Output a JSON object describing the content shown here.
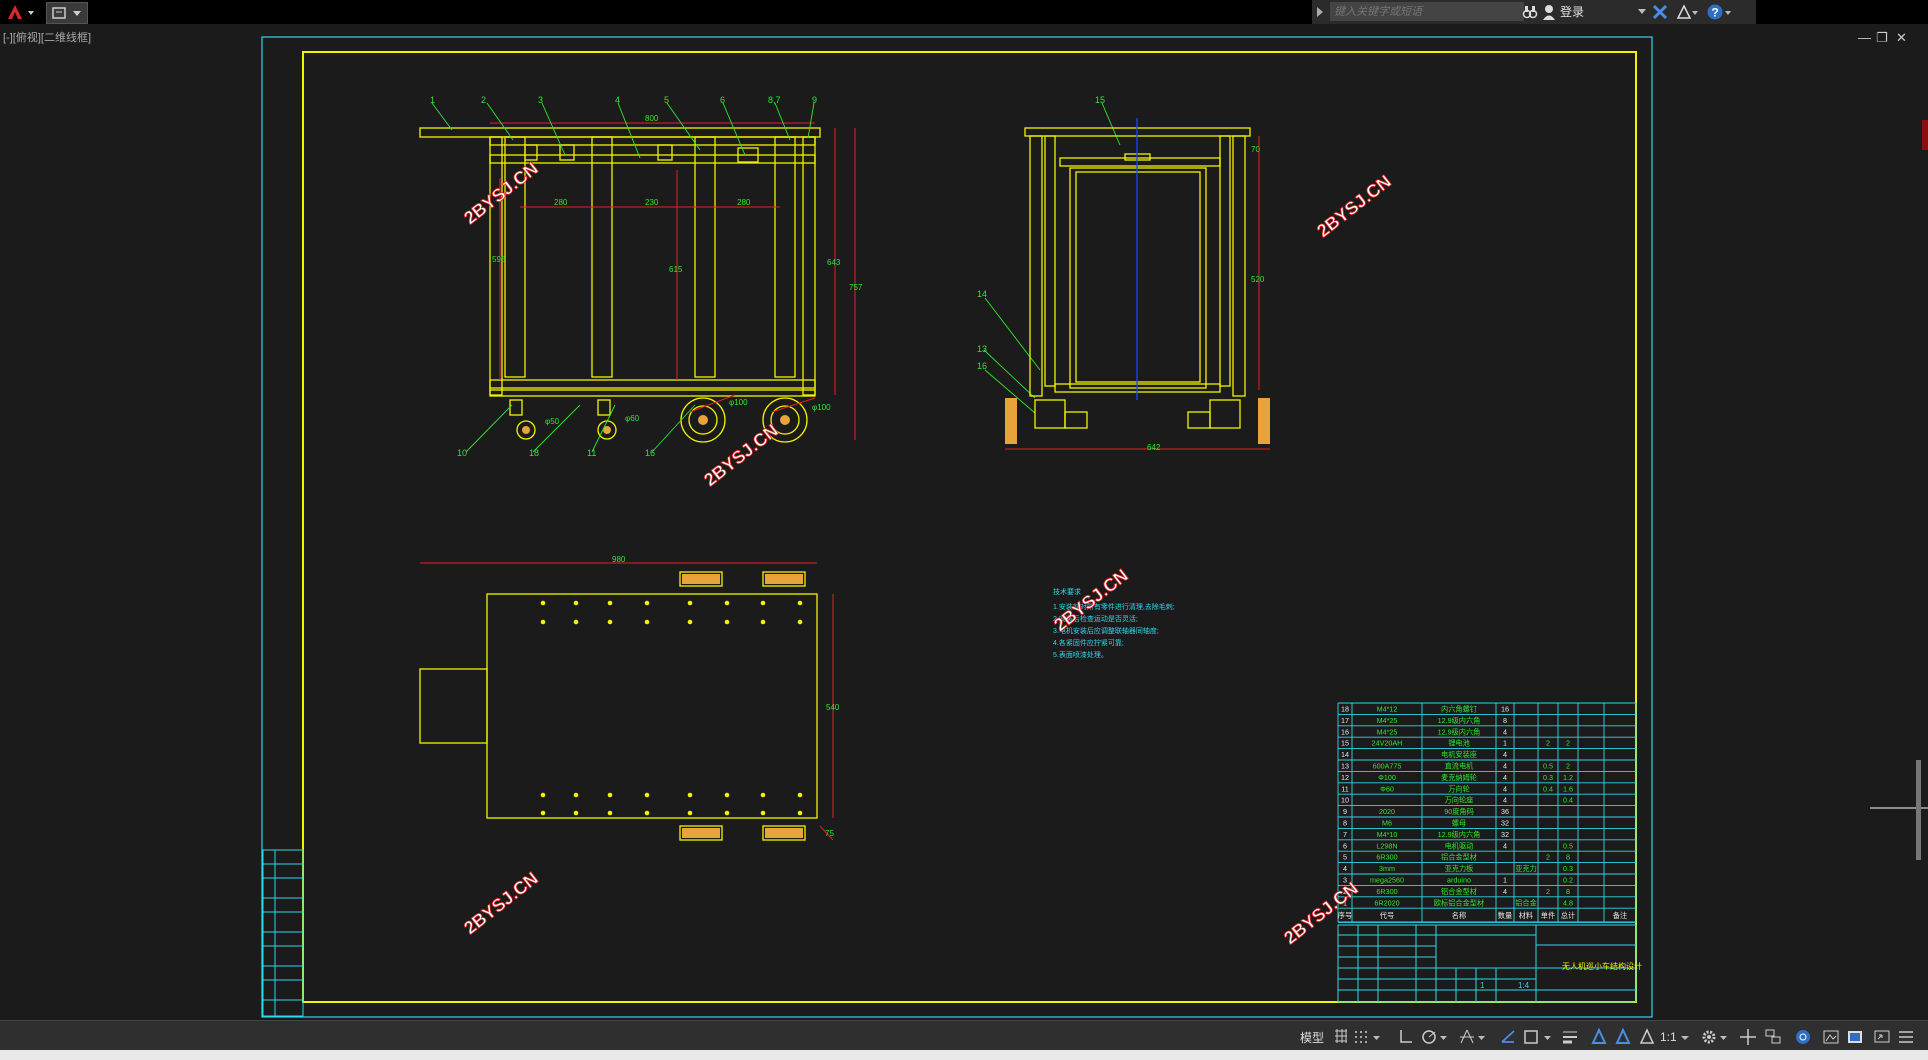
{
  "topbar": {
    "app_icon": "autocad-a-icon",
    "search_placeholder": "键入关键字或短语",
    "login_label": "登录"
  },
  "viewport": {
    "label": "[-][俯视][二维线框]"
  },
  "drawing": {
    "watermark": "2BYSJ.CN",
    "balloons": [
      "1",
      "2",
      "3",
      "4",
      "5",
      "6",
      "8,7",
      "9",
      "10",
      "18",
      "11",
      "16",
      "15",
      "14",
      "13",
      "16"
    ],
    "dims_front": {
      "top": "800",
      "d1": "280",
      "d2": "230",
      "d3": "280",
      "h1": "595",
      "h2": "615",
      "h3": "643",
      "h4": "757",
      "w1": "φ50",
      "w2": "φ60",
      "w3": "φ100",
      "w4": "φ100"
    },
    "dims_side": {
      "h1": "70",
      "h2": "520",
      "bottom": "642"
    },
    "dims_top": {
      "width": "980",
      "height": "540",
      "small": "75"
    },
    "notes_title": "技术要求",
    "notes": [
      "1.安装前对所有零件进行清理,去除毛刺;",
      "2.安装后检查运动是否灵活;",
      "3.电机安装后应调整联轴器同轴度;",
      "4.各紧固件应拧紧可靠;",
      "5.表面喷漆处理。"
    ],
    "bom": [
      {
        "no": "18",
        "code": "M4*12",
        "name": "内六角螺钉",
        "qty": "16",
        "mat": "",
        "w1": "",
        "w2": ""
      },
      {
        "no": "17",
        "code": "M4*25",
        "name": "12.9级内六角",
        "qty": "8",
        "mat": "",
        "w1": "",
        "w2": ""
      },
      {
        "no": "16",
        "code": "M4*25",
        "name": "12.9级内六角",
        "qty": "4",
        "mat": "",
        "w1": "",
        "w2": ""
      },
      {
        "no": "15",
        "code": "24V20AH",
        "name": "锂电池",
        "qty": "1",
        "mat": "",
        "w1": "2",
        "w2": "2"
      },
      {
        "no": "14",
        "code": "",
        "name": "电机安装座",
        "qty": "4",
        "mat": "",
        "w1": "",
        "w2": ""
      },
      {
        "no": "13",
        "code": "600A775",
        "name": "直流电机",
        "qty": "4",
        "mat": "",
        "w1": "0.5",
        "w2": "2"
      },
      {
        "no": "12",
        "code": "Φ100",
        "name": "麦克纳姆轮",
        "qty": "4",
        "mat": "",
        "w1": "0.3",
        "w2": "1.2"
      },
      {
        "no": "11",
        "code": "Φ60",
        "name": "万向轮",
        "qty": "4",
        "mat": "",
        "w1": "0.4",
        "w2": "1.6"
      },
      {
        "no": "10",
        "code": "",
        "name": "万向轮座",
        "qty": "4",
        "mat": "",
        "w1": "",
        "w2": "0.4"
      },
      {
        "no": "9",
        "code": "2020",
        "name": "90度角码",
        "qty": "36",
        "mat": "",
        "w1": "",
        "w2": ""
      },
      {
        "no": "8",
        "code": "M6",
        "name": "螺母",
        "qty": "32",
        "mat": "",
        "w1": "",
        "w2": ""
      },
      {
        "no": "7",
        "code": "M4*10",
        "name": "12.9级内六角",
        "qty": "32",
        "mat": "",
        "w1": "",
        "w2": ""
      },
      {
        "no": "6",
        "code": "L298N",
        "name": "电机驱动",
        "qty": "4",
        "mat": "",
        "w1": "",
        "w2": "0.5"
      },
      {
        "no": "5",
        "code": "6R300",
        "name": "铝合金型材",
        "qty": "",
        "mat": "",
        "w1": "2",
        "w2": "8"
      },
      {
        "no": "4",
        "code": "3mm",
        "name": "亚克力板",
        "qty": "",
        "mat": "亚克力",
        "w1": "",
        "w2": "0.3"
      },
      {
        "no": "3",
        "code": "mega2560",
        "name": "arduino",
        "qty": "1",
        "mat": "",
        "w1": "",
        "w2": "0.2"
      },
      {
        "no": "2",
        "code": "6R300",
        "name": "铝合金型材",
        "qty": "4",
        "mat": "",
        "w1": "2",
        "w2": "8"
      },
      {
        "no": "1",
        "code": "6R2020",
        "name": "欧标铝合金型材",
        "qty": "",
        "mat": "铝合金",
        "w1": "",
        "w2": "4.8"
      }
    ],
    "bom_header": [
      "序号",
      "代号",
      "名称",
      "数量",
      "材料",
      "单件",
      "总计",
      "备注"
    ],
    "title_block_name": "无人机巡小车结构设计",
    "title_block_scale": "1:4",
    "title_block_sheet": "1"
  },
  "statusbar": {
    "model_label": "模型",
    "scale_label": "1:1"
  }
}
